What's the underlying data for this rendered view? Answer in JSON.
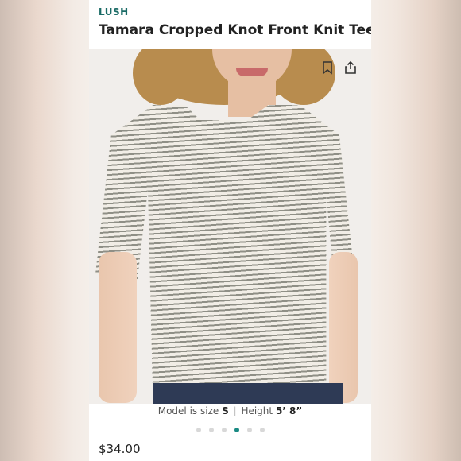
{
  "listing": {
    "brand": "LUSH",
    "title": "Tamara Cropped Knot Front Knit Tee",
    "price": "$34.00"
  },
  "photo": {
    "caption_prefix": "Model is size",
    "size": "S",
    "separator": "|",
    "height_label": "Height",
    "height_value": "5’ 8”"
  },
  "actions": {
    "bookmark_icon": "bookmark-icon",
    "share_icon": "share-icon"
  },
  "carousel": {
    "count": 6,
    "active_index": 3,
    "active_color": "#1a8a83"
  },
  "colors": {
    "brand": "#1a6b66",
    "text": "#222222"
  }
}
